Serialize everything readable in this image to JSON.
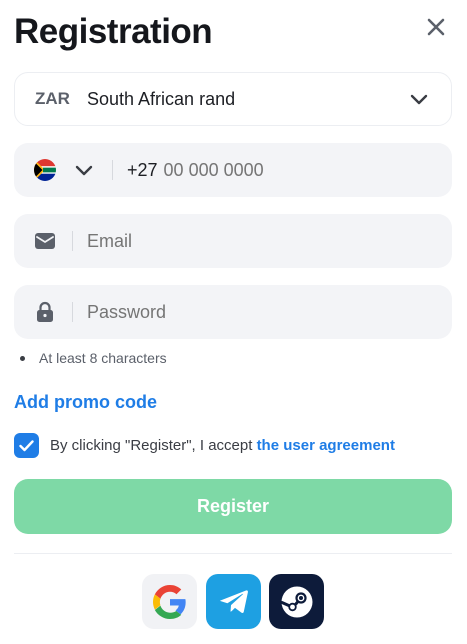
{
  "header": {
    "title": "Registration"
  },
  "currency": {
    "code": "ZAR",
    "name": "South African rand"
  },
  "phone": {
    "country_code": "+27",
    "placeholder": "00 000 0000"
  },
  "email": {
    "placeholder": "Email"
  },
  "password": {
    "placeholder": "Password"
  },
  "password_hint": "At least 8 characters",
  "promo_link": "Add promo code",
  "agreement": {
    "text": "By clicking \"Register\", I accept ",
    "link": "the user agreement",
    "checked": true
  },
  "register_label": "Register",
  "social": [
    "google-icon",
    "telegram-icon",
    "steam-icon"
  ],
  "colors": {
    "accent": "#1f7de6",
    "register_bg": "#7ed9a6",
    "field_bg": "#f3f4f7"
  }
}
